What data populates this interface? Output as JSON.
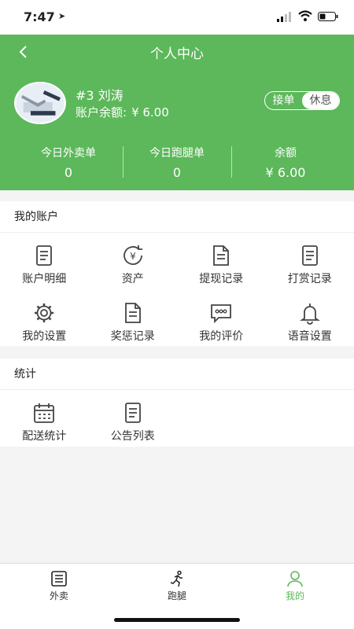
{
  "status": {
    "time": "7:47"
  },
  "header": {
    "title": "个人中心"
  },
  "profile": {
    "name": "#3 刘涛",
    "balance_label": "账户余额:",
    "balance_value": "¥ 6.00",
    "toggle_on": "接单",
    "toggle_off": "休息"
  },
  "stats": [
    {
      "label": "今日外卖单",
      "value": "0"
    },
    {
      "label": "今日跑腿单",
      "value": "0"
    },
    {
      "label": "余额",
      "value": "¥ 6.00"
    }
  ],
  "account": {
    "title": "我的账户",
    "items": [
      {
        "label": "账户明细",
        "icon": "list-doc-icon"
      },
      {
        "label": "资产",
        "icon": "yuan-refresh-icon"
      },
      {
        "label": "提现记录",
        "icon": "doc-icon"
      },
      {
        "label": "打赏记录",
        "icon": "list-doc-icon"
      },
      {
        "label": "我的设置",
        "icon": "gear-icon"
      },
      {
        "label": "奖惩记录",
        "icon": "doc-icon"
      },
      {
        "label": "我的评价",
        "icon": "chat-icon"
      },
      {
        "label": "语音设置",
        "icon": "bell-icon"
      }
    ]
  },
  "stats_section": {
    "title": "统计",
    "items": [
      {
        "label": "配送统计",
        "icon": "calendar-icon"
      },
      {
        "label": "公告列表",
        "icon": "list-doc-icon"
      }
    ]
  },
  "tabbar": [
    {
      "label": "外卖",
      "icon": "list-icon"
    },
    {
      "label": "跑腿",
      "icon": "runner-icon"
    },
    {
      "label": "我的",
      "icon": "person-icon",
      "active": true
    }
  ],
  "colors": {
    "brand": "#5cb85a"
  }
}
